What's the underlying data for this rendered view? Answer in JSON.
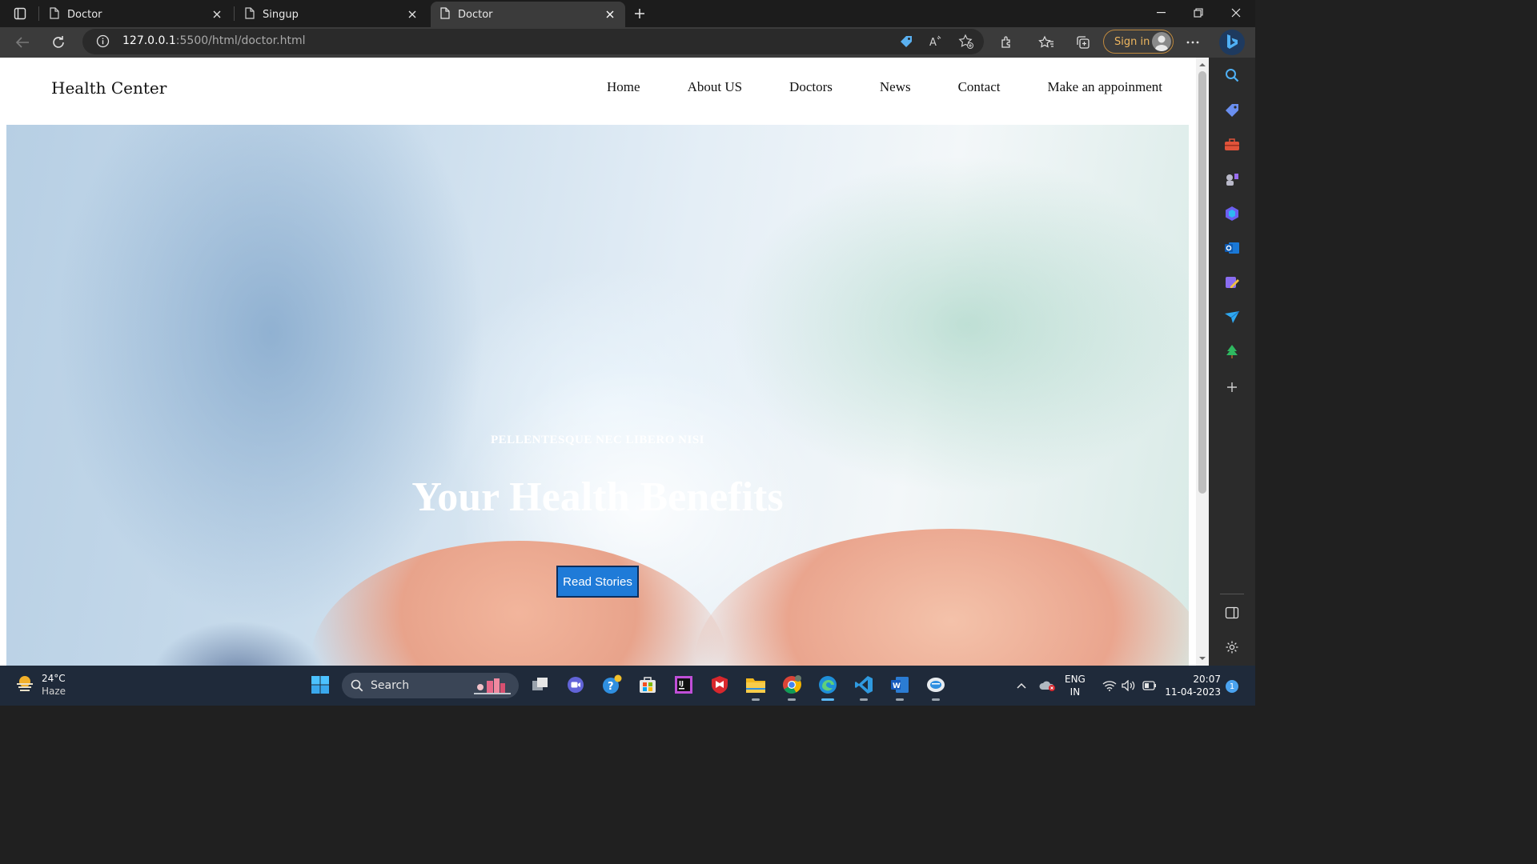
{
  "browser": {
    "tabs": [
      {
        "title": "Doctor",
        "active": false
      },
      {
        "title": "Singup",
        "active": false
      },
      {
        "title": "Doctor",
        "active": true
      }
    ],
    "address": {
      "host": "127.0.0.1",
      "path": ":5500/html/doctor.html"
    },
    "signin_label": "Sign in"
  },
  "site": {
    "brand": "Health Center",
    "nav": [
      "Home",
      "About US",
      "Doctors",
      "News",
      "Contact",
      "Make an appoinment"
    ],
    "hero": {
      "kicker": "PELLENTESQUE NEC LIBERO NISI",
      "headline": "Your Health Benefits",
      "cta": "Read Stories"
    }
  },
  "taskbar": {
    "weather": {
      "temp": "24°C",
      "condition": "Haze"
    },
    "search_label": "Search",
    "lang": {
      "line1": "ENG",
      "line2": "IN"
    },
    "clock": {
      "time": "20:07",
      "date": "11-04-2023"
    },
    "notifications": "1"
  },
  "colors": {
    "accent_button": "#1f7bd8",
    "signin_border": "#c08a3e",
    "edge_blue": "#5cb8f5"
  }
}
